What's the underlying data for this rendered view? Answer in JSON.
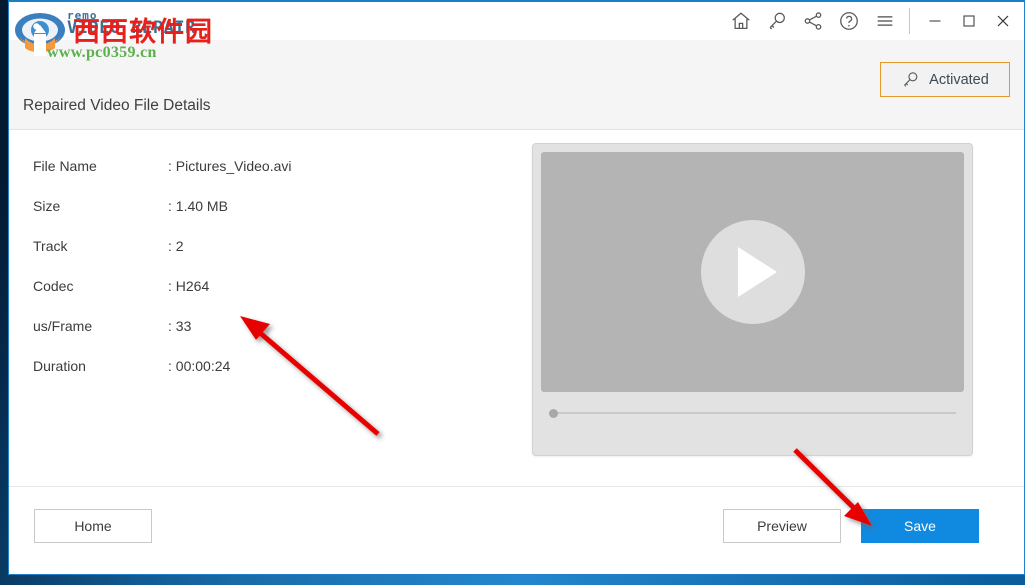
{
  "window": {
    "titlebar_icons": [
      {
        "name": "home-icon",
        "label": "Home"
      },
      {
        "name": "key-icon",
        "label": "Activate"
      },
      {
        "name": "share-icon",
        "label": "Share"
      },
      {
        "name": "help-icon",
        "label": "Help"
      },
      {
        "name": "menu-icon",
        "label": "Menu"
      }
    ],
    "controls": [
      {
        "name": "minimize-button",
        "label": "Minimize"
      },
      {
        "name": "maximize-button",
        "label": "Maximize"
      },
      {
        "name": "close-button",
        "label": "Close"
      }
    ]
  },
  "brand": {
    "line1": "remo",
    "line2": "VIDEO REPAIR",
    "watermark_cn": "西西软件园",
    "watermark_url": "www.pc0359.cn"
  },
  "header": {
    "page_title": "Repaired Video File Details",
    "activated_label": "Activated"
  },
  "details": {
    "rows": [
      {
        "label": "File Name",
        "value": ": Pictures_Video.avi"
      },
      {
        "label": "Size",
        "value": ": 1.40 MB"
      },
      {
        "label": "Track",
        "value": ": 2"
      },
      {
        "label": "Codec",
        "value": ": H264"
      },
      {
        "label": "us/Frame",
        "value": ": 33"
      },
      {
        "label": "Duration",
        "value": ": 00:00:24"
      }
    ]
  },
  "player": {
    "play_label": "Play",
    "progress_percent": 0
  },
  "footer": {
    "home_label": "Home",
    "preview_label": "Preview",
    "save_label": "Save"
  },
  "colors": {
    "accent_blue": "#1089e0",
    "activated_border": "#e09a2c",
    "window_border": "#2080c8",
    "header_bg": "#f5f5f5",
    "watermark_green": "#5eb04e",
    "watermark_red": "#e8201c",
    "annotation_red": "#e60000"
  },
  "annotations": [
    {
      "name": "arrow-to-details",
      "direction": "up-left"
    },
    {
      "name": "arrow-to-save-button",
      "direction": "down-right"
    }
  ]
}
